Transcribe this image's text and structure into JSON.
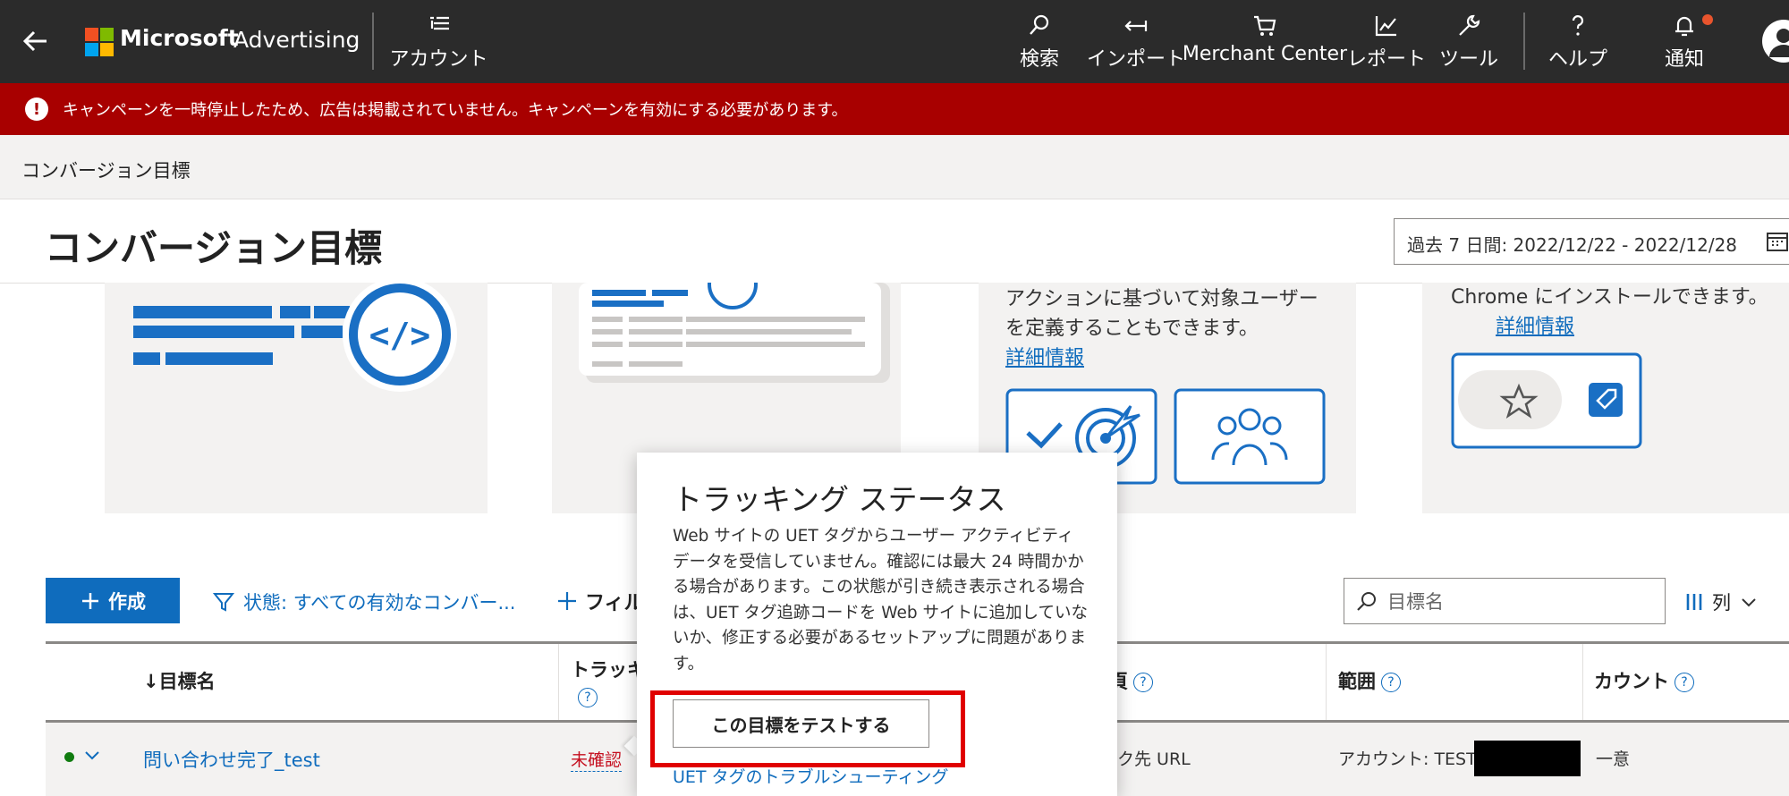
{
  "topbar": {
    "brand": "Microsoft",
    "brand_sub": "Advertising",
    "account_label": "アカウント",
    "nav": [
      {
        "label": "検索",
        "icon": "search-icon"
      },
      {
        "label": "インポート",
        "icon": "import-icon"
      },
      {
        "label": "Merchant Center",
        "icon": "cart-icon"
      },
      {
        "label": "レポート",
        "icon": "chart-icon"
      },
      {
        "label": "ツール",
        "icon": "wrench-icon"
      },
      {
        "label": "ヘルプ",
        "icon": "help-icon"
      },
      {
        "label": "通知",
        "icon": "bell-icon"
      }
    ]
  },
  "alert": {
    "text": "キャンペーンを一時停止したため、広告は掲載されていません。キャンペーンを有効にする必要があります。"
  },
  "breadcrumb": "コンバージョン目標",
  "page": {
    "title": "コンバージョン目標",
    "date_range": "過去 7 日間: 2022/12/22 - 2022/12/28"
  },
  "cards": {
    "card3_text": "アクションに基づいて対象ユーザーを定義することもできます。",
    "card3_link": "詳細情報",
    "card4_text": "Chrome にインストールできます。",
    "card4_link": "詳細情報"
  },
  "toolbar": {
    "create_label": "作成",
    "filter_label": "状態: すべての有効なコンバー...",
    "add_filter_label": "フィル",
    "search_placeholder": "目標名",
    "columns_label": "列"
  },
  "table": {
    "headers": {
      "name": "↓目標名",
      "tracking": "トラッキ",
      "type": "頁",
      "scope": "範囲",
      "count": "カウント"
    },
    "row": {
      "name": "問い合わせ完了_test",
      "tracking": "未確認",
      "type": "ク先 URL",
      "scope": "アカウント: TEST",
      "count": "一意"
    }
  },
  "popover": {
    "title": "トラッキング ステータス",
    "body": "Web サイトの UET タグからユーザー アクティビティ データを受信していません。確認には最大 24 時間かかる場合があります。この状態が引き続き表示される場合は、UET タグ追跡コードを Web サイトに追加していないか、修正する必要があるセットアップに問題があります。",
    "test_button": "この目標をテストする",
    "troubleshoot_link": "UET タグのトラブルシューティング"
  },
  "colors": {
    "topbar": "#2b2b2b",
    "alert": "#a80000",
    "accent": "#0f6cbd",
    "highlight": "#e00000"
  }
}
